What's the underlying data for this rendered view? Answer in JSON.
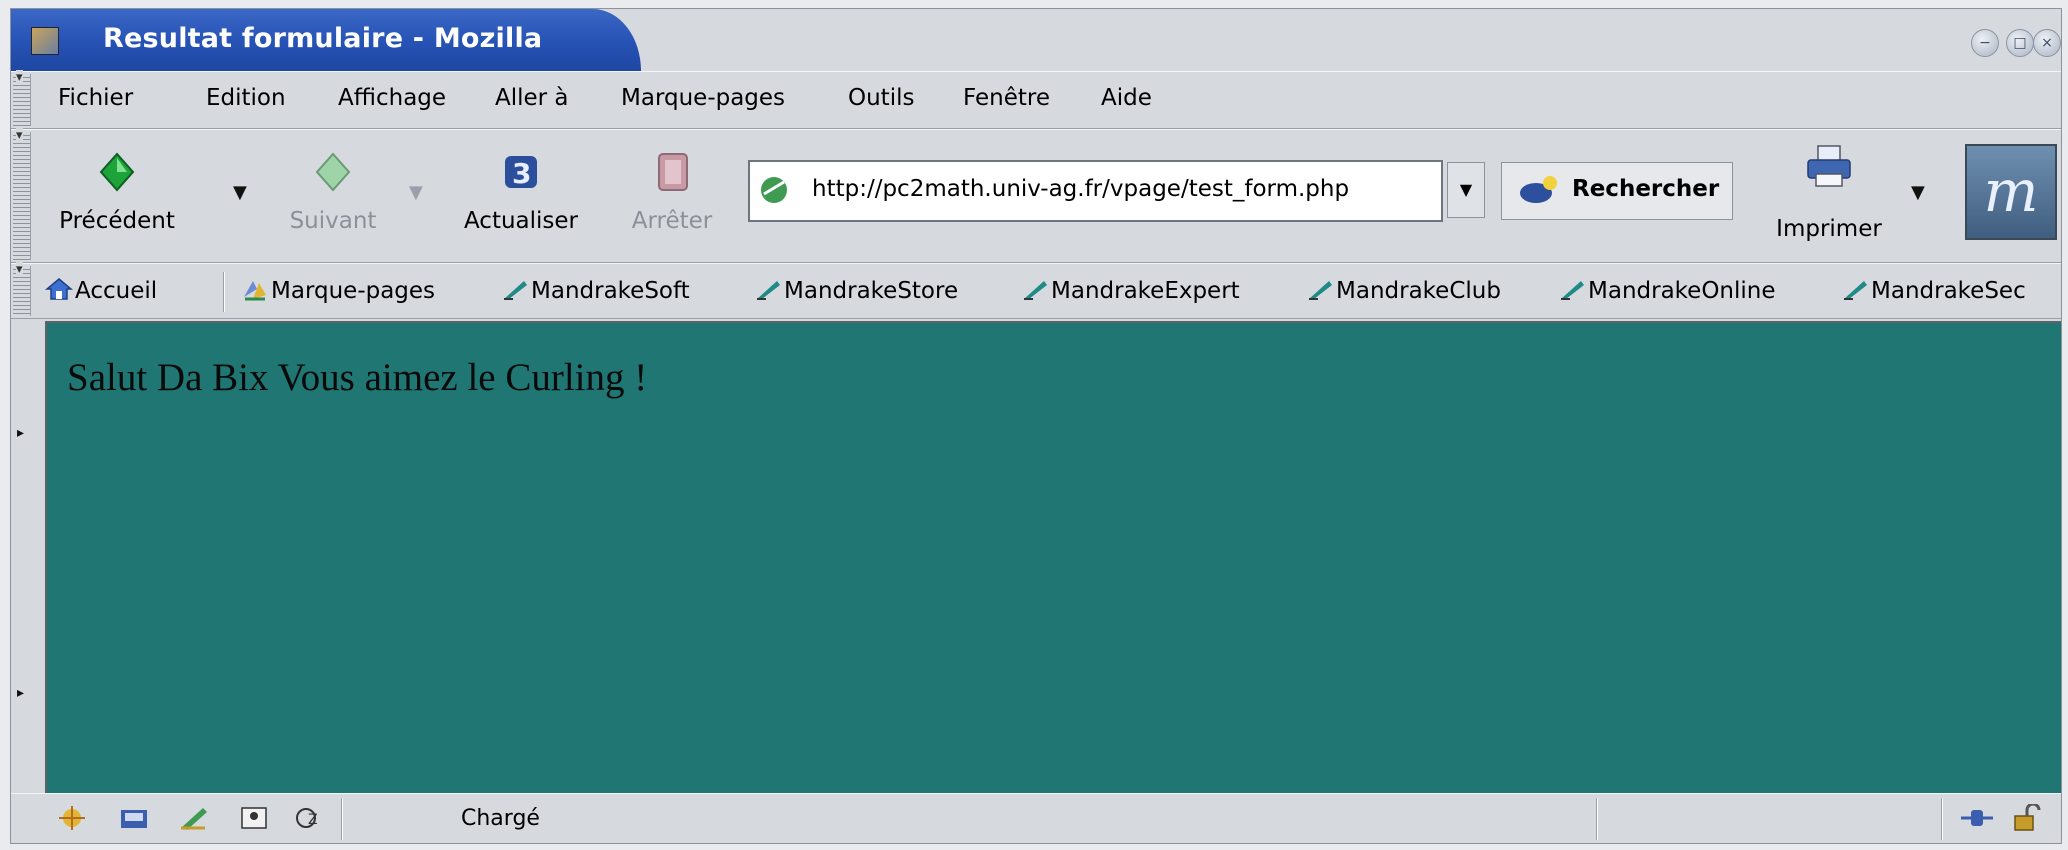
{
  "window": {
    "title": "Resultat formulaire - Mozilla"
  },
  "menu": {
    "items": [
      "Fichier",
      "Edition",
      "Affichage",
      "Aller à",
      "Marque-pages",
      "Outils",
      "Fenêtre",
      "Aide"
    ]
  },
  "navigation": {
    "back_label": "Précédent",
    "forward_label": "Suivant",
    "reload_label": "Actualiser",
    "stop_label": "Arrêter",
    "url": "http://pc2math.univ-ag.fr/vpage/test_form.php",
    "search_label": "Rechercher",
    "print_label": "Imprimer"
  },
  "bookmarks": {
    "home_label": "Accueil",
    "bookmarks_label": "Marque-pages",
    "items": [
      "MandrakeSoft",
      "MandrakeStore",
      "MandrakeExpert",
      "MandrakeClub",
      "MandrakeOnline",
      "MandrakeSec"
    ]
  },
  "content": {
    "text": "Salut Da Bix Vous aimez le Curling !"
  },
  "status": {
    "text": "Chargé"
  },
  "colors": {
    "title_bar": "#2552b4",
    "page_background": "#1f7672",
    "chrome": "#d6d9de"
  },
  "icons": [
    "back-arrow-icon",
    "forward-arrow-icon",
    "reload-icon",
    "stop-icon",
    "page-site-icon",
    "search-icon",
    "printer-icon",
    "mandrake-logo-icon",
    "home-icon",
    "bookmark-folder-icon",
    "bookmark-link-icon",
    "navigator-icon",
    "mail-icon",
    "composer-icon",
    "address-book-icon",
    "chatzilla-icon",
    "online-status-icon",
    "security-lock-icon"
  ]
}
